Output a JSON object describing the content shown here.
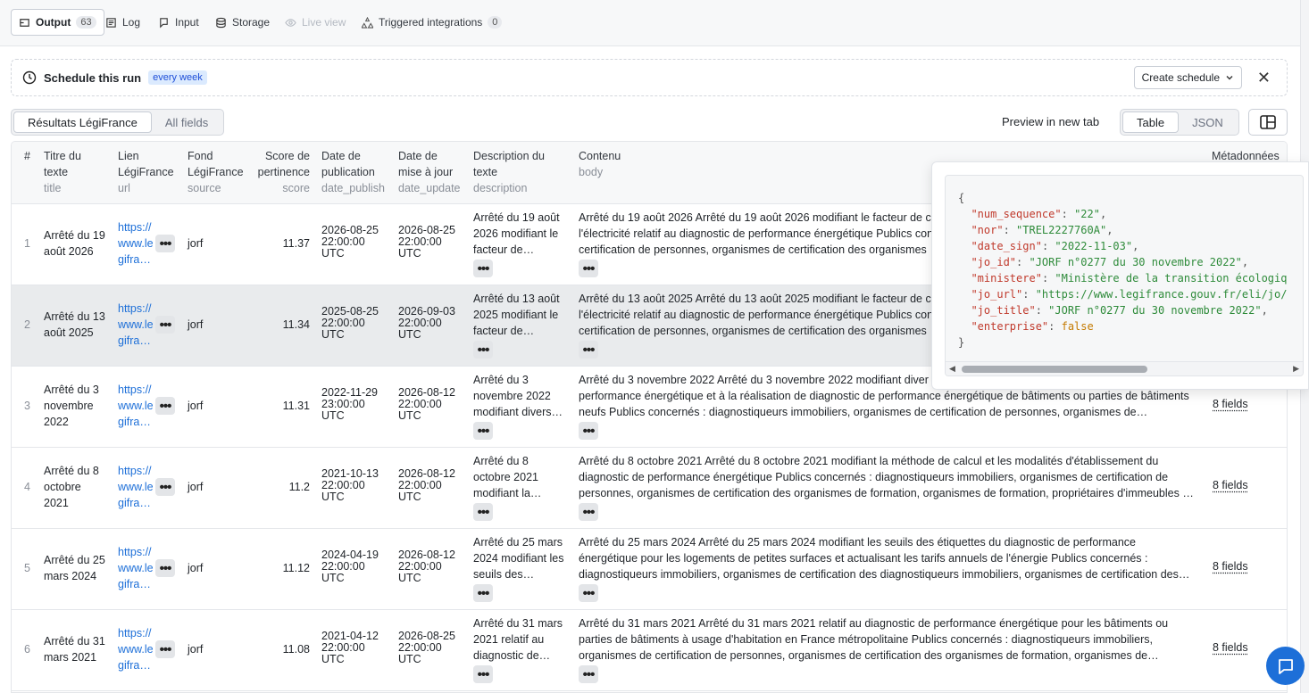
{
  "tabs": [
    {
      "label": "Output",
      "count": "63",
      "icon": "output-icon"
    },
    {
      "label": "Log",
      "icon": "log-icon"
    },
    {
      "label": "Input",
      "icon": "input-icon"
    },
    {
      "label": "Storage",
      "icon": "storage-icon"
    },
    {
      "label": "Live view",
      "icon": "eye-icon"
    },
    {
      "label": "Triggered integrations",
      "count": "0",
      "icon": "integrations-icon"
    }
  ],
  "schedule": {
    "title": "Schedule this run",
    "frequency": "every week",
    "create_label": "Create schedule"
  },
  "views": {
    "legifrance": "Résultats LégiFrance",
    "all_fields": "All fields",
    "preview": "Preview in new tab",
    "table": "Table",
    "json": "JSON"
  },
  "columns": {
    "index": "#",
    "title": [
      "Titre du",
      "texte",
      "title"
    ],
    "url": [
      "Lien",
      "LégiFrance",
      "url"
    ],
    "source": [
      "Fond",
      "LégiFrance",
      "source"
    ],
    "score": [
      "Score de",
      "pertinence",
      "score"
    ],
    "date_publish": [
      "Date de",
      "publication",
      "date_publish"
    ],
    "date_update": [
      "Date de",
      "mise à jour",
      "date_update"
    ],
    "description": [
      "Description du",
      "texte",
      "description"
    ],
    "body": [
      "Contenu",
      "body"
    ],
    "meta": "Métadonnées"
  },
  "rows": [
    {
      "n": "1",
      "title": [
        "Arrêté du 19",
        "août 2026"
      ],
      "url": [
        "https://",
        "www.le",
        "gifra…"
      ],
      "source": "jorf",
      "score": "11.37",
      "pub": [
        "2026-08-25",
        "22:00:00",
        "UTC"
      ],
      "upd": [
        "2026-08-25",
        "22:00:00",
        "UTC"
      ],
      "desc": [
        "Arrêté du 19 août",
        "2026 modifiant le",
        "facteur de…"
      ],
      "body": [
        "Arrêté du 19 août 2026 Arrêté du 19 août 2026 modifiant le facteur de c",
        "l'électricité relatif au diagnostic de performance énergétique Publics con",
        "certification de personnes, organismes de certification des organismes"
      ],
      "meta": ""
    },
    {
      "n": "2",
      "title": [
        "Arrêté du 13",
        "août 2025"
      ],
      "url": [
        "https://",
        "www.le",
        "gifra…"
      ],
      "source": "jorf",
      "score": "11.34",
      "pub": [
        "2025-08-25",
        "22:00:00",
        "UTC"
      ],
      "upd": [
        "2026-09-03",
        "22:00:00",
        "UTC"
      ],
      "desc": [
        "Arrêté du 13 août",
        "2025 modifiant le",
        "facteur de…"
      ],
      "body": [
        "Arrêté du 13 août 2025 Arrêté du 13 août 2025 modifiant le facteur de c",
        "l'électricité relatif au diagnostic de performance énergétique Publics con",
        "certification de personnes, organismes de certification des organismes"
      ],
      "meta": ""
    },
    {
      "n": "3",
      "title": [
        "Arrêté du 3",
        "novembre",
        "2022"
      ],
      "url": [
        "https://",
        "www.le",
        "gifra…"
      ],
      "source": "jorf",
      "score": "11.31",
      "pub": [
        "2022-11-29",
        "23:00:00",
        "UTC"
      ],
      "upd": [
        "2026-08-12",
        "22:00:00",
        "UTC"
      ],
      "desc": [
        "Arrêté du 3",
        "novembre 2022",
        "modifiant divers…"
      ],
      "body": [
        "Arrêté du 3 novembre 2022 Arrêté du 3 novembre 2022 modifiant diver",
        "performance énergétique et à la réalisation de diagnostic de performance énergétique de bâtiments ou parties de bâtiments",
        "neufs Publics concernés : diagnostiqueurs immobiliers, organismes de certification de personnes, organismes de…"
      ],
      "meta": "8 fields"
    },
    {
      "n": "4",
      "title": [
        "Arrêté du 8",
        "octobre",
        "2021"
      ],
      "url": [
        "https://",
        "www.le",
        "gifra…"
      ],
      "source": "jorf",
      "score": "11.2",
      "pub": [
        "2021-10-13",
        "22:00:00",
        "UTC"
      ],
      "upd": [
        "2026-08-12",
        "22:00:00",
        "UTC"
      ],
      "desc": [
        "Arrêté du 8",
        "octobre 2021",
        "modifiant la…"
      ],
      "body": [
        "Arrêté du 8 octobre 2021 Arrêté du 8 octobre 2021 modifiant la méthode de calcul et les modalités d'établissement du",
        "diagnostic de performance énergétique Publics concernés : diagnostiqueurs immobiliers, organismes de certification de",
        "personnes, organismes de certification des organismes de formation, organismes de formation, propriétaires d'immeubles …"
      ],
      "meta": "8 fields"
    },
    {
      "n": "5",
      "title": [
        "Arrêté du 25",
        "mars 2024"
      ],
      "url": [
        "https://",
        "www.le",
        "gifra…"
      ],
      "source": "jorf",
      "score": "11.12",
      "pub": [
        "2024-04-19",
        "22:00:00",
        "UTC"
      ],
      "upd": [
        "2026-08-12",
        "22:00:00",
        "UTC"
      ],
      "desc": [
        "Arrêté du 25 mars",
        "2024 modifiant les",
        "seuils des…"
      ],
      "body": [
        "Arrêté du 25 mars 2024 Arrêté du 25 mars 2024 modifiant les seuils des étiquettes du diagnostic de performance",
        "énergétique pour les logements de petites surfaces et actualisant les tarifs annuels de l'énergie Publics concernés :",
        "diagnostiqueurs immobiliers, organismes de certification des diagnostiqueurs immobiliers, organismes de certification des…"
      ],
      "meta": "8 fields"
    },
    {
      "n": "6",
      "title": [
        "Arrêté du 31",
        "mars 2021"
      ],
      "url": [
        "https://",
        "www.le",
        "gifra…"
      ],
      "source": "jorf",
      "score": "11.08",
      "pub": [
        "2021-04-12",
        "22:00:00",
        "UTC"
      ],
      "upd": [
        "2026-08-25",
        "22:00:00",
        "UTC"
      ],
      "desc": [
        "Arrêté du 31 mars",
        "2021 relatif au",
        "diagnostic de…"
      ],
      "body": [
        "Arrêté du 31 mars 2021 Arrêté du 31 mars 2021 relatif au diagnostic de performance énergétique pour les bâtiments ou",
        "parties de bâtiments à usage d'habitation en France métropolitaine Publics concernés : diagnostiqueurs immobiliers,",
        "organismes de certification de personnes, organismes de certification des organismes de formation, organismes de…"
      ],
      "meta": "8 fields"
    }
  ],
  "json_popover": {
    "open": "{",
    "close": "}",
    "entries": [
      {
        "key": "\"num_sequence\"",
        "value": "\"22\"",
        "type": "str",
        "comma": ","
      },
      {
        "key": "\"nor\"",
        "value": "\"TREL2227760A\"",
        "type": "str",
        "comma": ","
      },
      {
        "key": "\"date_sign\"",
        "value": "\"2022-11-03\"",
        "type": "str",
        "comma": ","
      },
      {
        "key": "\"jo_id\"",
        "value": "\"JORF n°0277 du 30 novembre 2022\"",
        "type": "str",
        "comma": ","
      },
      {
        "key": "\"ministere\"",
        "value": "\"Ministère de la transition écologiq",
        "type": "str",
        "comma": ""
      },
      {
        "key": "\"jo_url\"",
        "value": "\"https://www.legifrance.gouv.fr/eli/jo/",
        "type": "str",
        "comma": ""
      },
      {
        "key": "\"jo_title\"",
        "value": "\"JORF n°0277 du 30 novembre 2022\"",
        "type": "str",
        "comma": ","
      },
      {
        "key": "\"enterprise\"",
        "value": "false",
        "type": "kw",
        "comma": ""
      }
    ]
  },
  "colors": {
    "accent": "#1d6fd8",
    "pill_bg": "#dbeafe",
    "string": "#2e8b3a",
    "key": "#c0392b"
  }
}
